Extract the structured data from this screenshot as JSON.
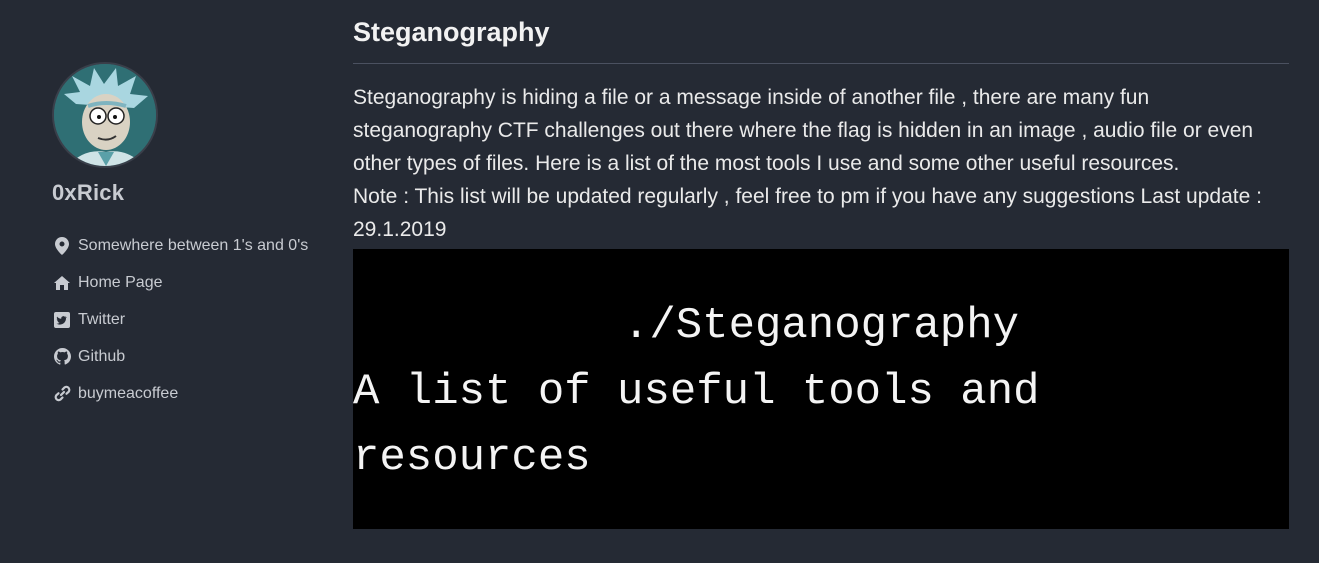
{
  "sidebar": {
    "author_name": "0xRick",
    "avatar_icon": "rick-avatar-icon",
    "links": [
      {
        "icon": "map-marker-icon",
        "label": "Somewhere between 1's and 0's"
      },
      {
        "icon": "home-icon",
        "label": "Home Page"
      },
      {
        "icon": "twitter-icon",
        "label": "Twitter"
      },
      {
        "icon": "github-icon",
        "label": "Github"
      },
      {
        "icon": "link-icon",
        "label": "buymeacoffee"
      }
    ]
  },
  "post": {
    "title": "Steganography",
    "intro": "Steganography is hiding a file or a message inside of another file , there are many fun steganography CTF challenges out there where the flag is hidden in an image , audio file or even other types of files. Here is a list of the most tools I use and some other useful resources.",
    "note": "Note : This list will be updated regularly , feel free to pm if you have any suggestions Last update : 29.1.2019",
    "banner": {
      "line1": "./Steganography",
      "line2": "A list of useful tools and resources"
    }
  },
  "colors": {
    "background": "#252a34",
    "text": "#eaeaea",
    "sidebar_text": "#c8cbd1",
    "banner_bg": "#000000"
  }
}
